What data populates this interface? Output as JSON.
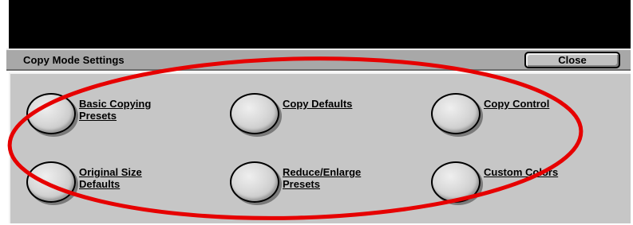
{
  "window": {
    "title": "Copy Mode Settings",
    "close_label": "Close"
  },
  "options": [
    {
      "line1": "Basic Copying",
      "line2": "Presets"
    },
    {
      "line1": "Copy Defaults",
      "line2": ""
    },
    {
      "line1": "Copy Control",
      "line2": ""
    },
    {
      "line1": "Original Size",
      "line2": "Defaults"
    },
    {
      "line1": "Reduce/Enlarge",
      "line2": "Presets"
    },
    {
      "line1": "Custom Colors",
      "line2": ""
    }
  ],
  "colors": {
    "top_bar": "#000000",
    "header": "#a8a8a8",
    "panel": "#c6c6c6",
    "annotation": "#e60000"
  },
  "annotation": {
    "shape": "ellipse",
    "color": "red"
  }
}
